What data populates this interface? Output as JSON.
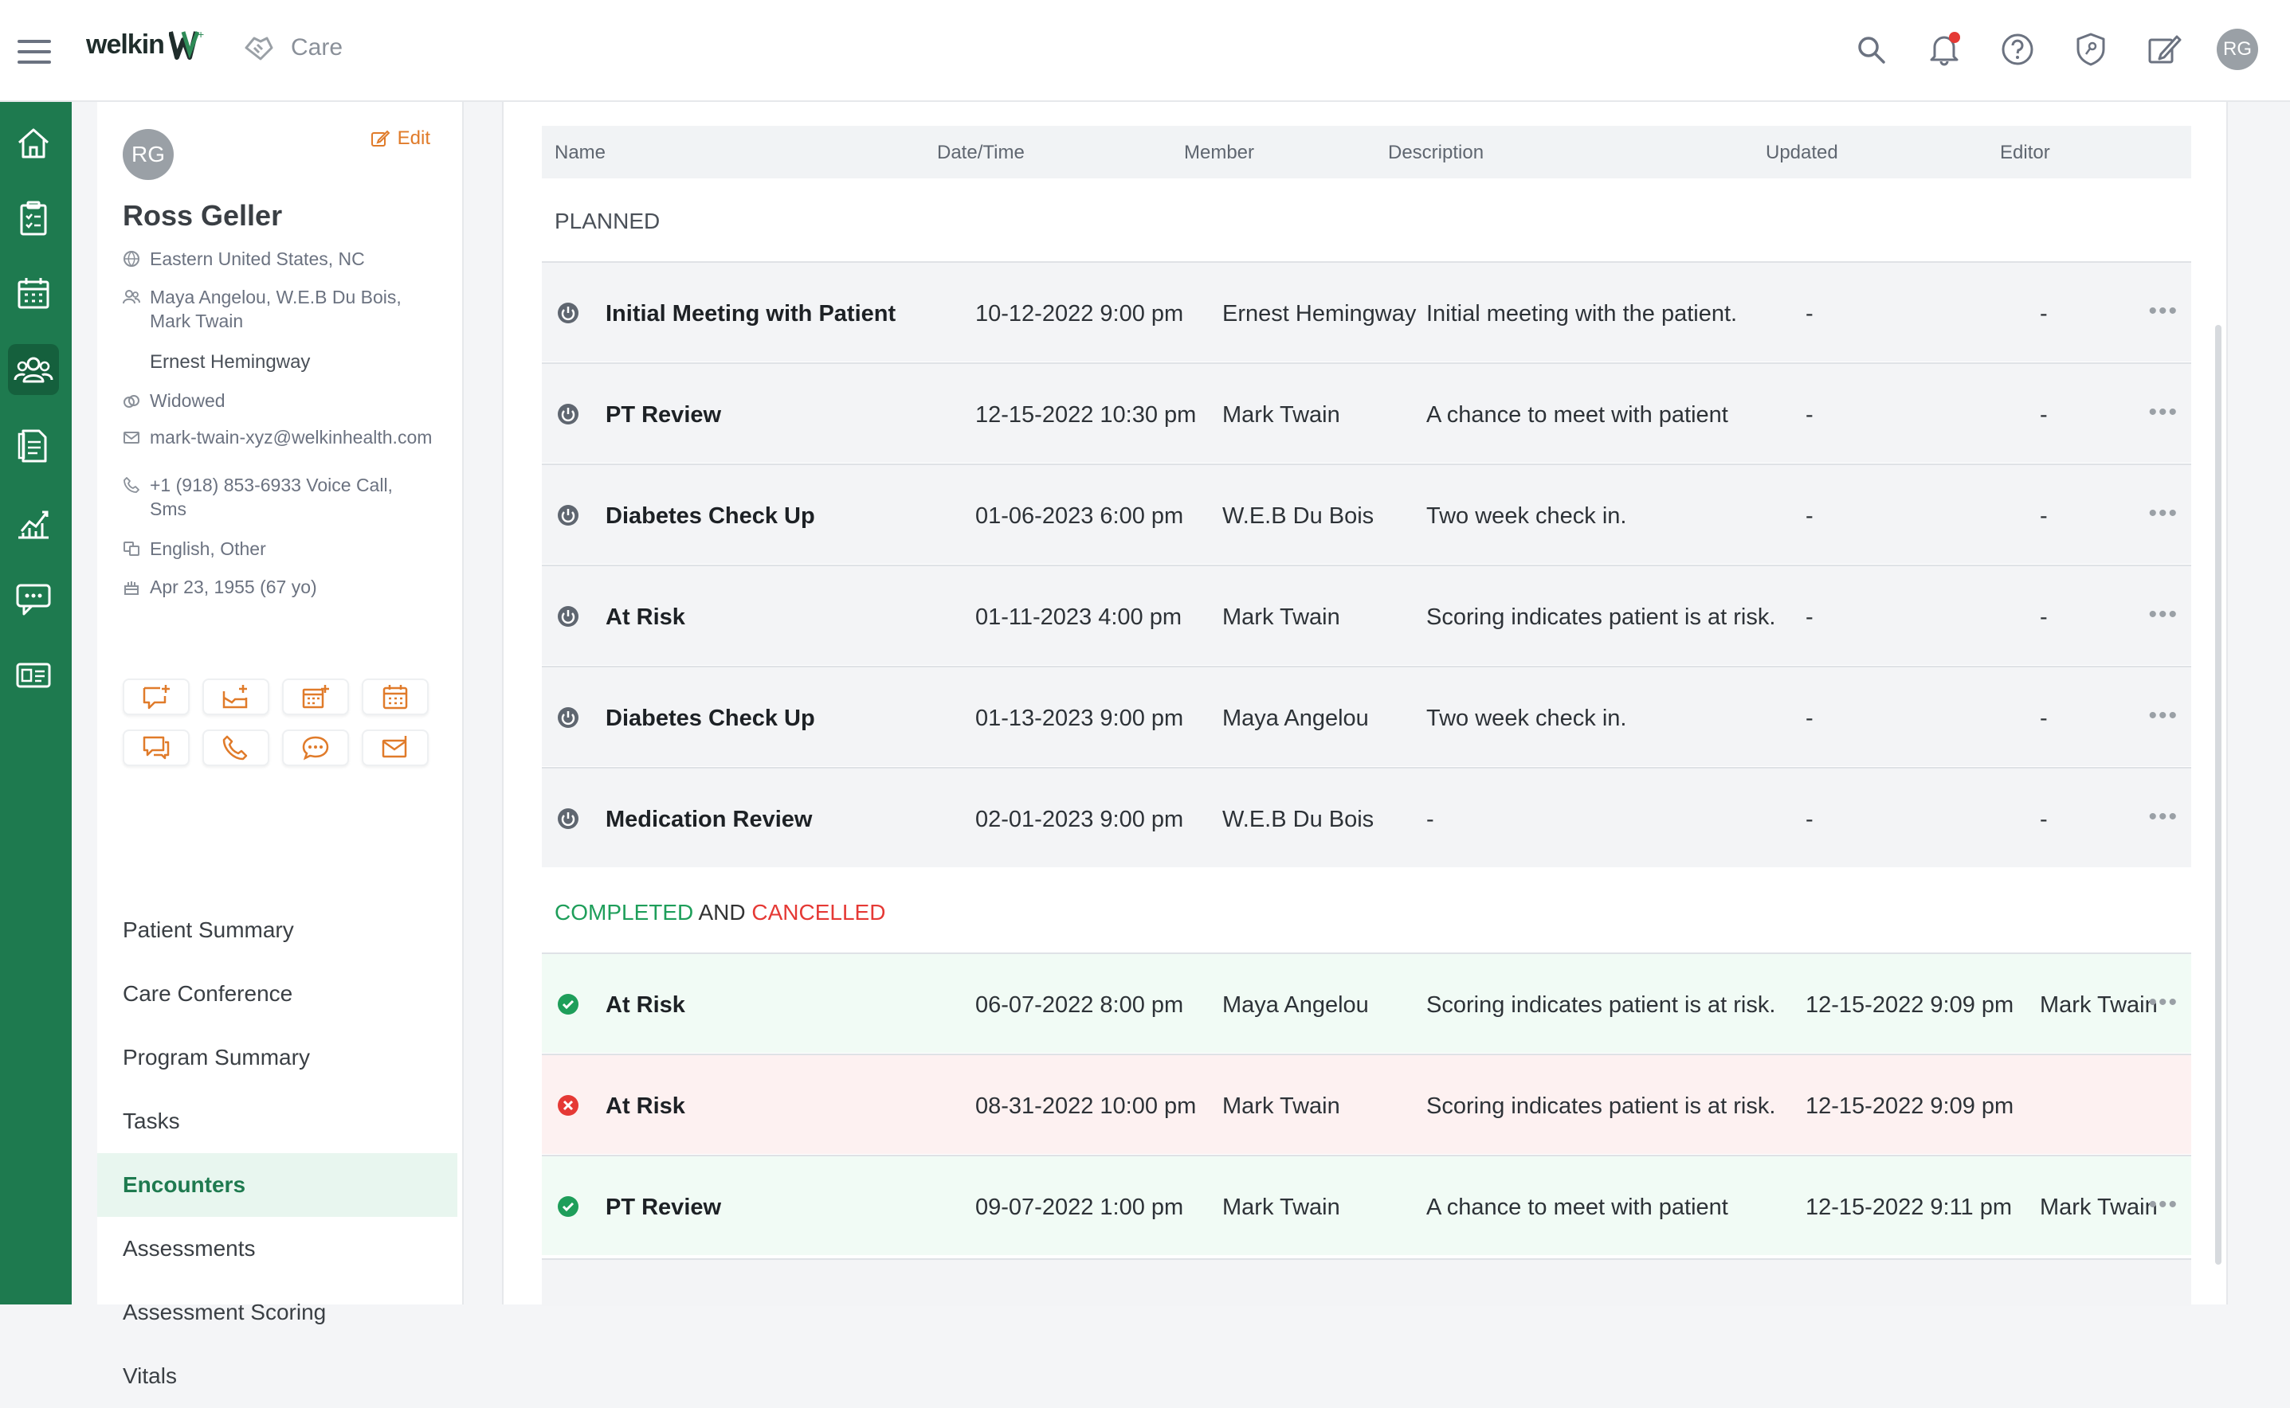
{
  "header": {
    "logo_text": "welkin",
    "module": "Care",
    "user_initials": "RG"
  },
  "patient": {
    "initials": "RG",
    "edit_label": "Edit",
    "name": "Ross Geller",
    "location": "Eastern United States, NC",
    "family_line1": "Maya Angelou, W.E.B Du Bois,",
    "family_line2": "Mark Twain",
    "provider": "Ernest Hemingway",
    "marital": "Widowed",
    "email": "mark-twain-xyz@welkinhealth.com",
    "phone_line1": "+1 (918) 853-6933 Voice Call,",
    "phone_line2": "Sms",
    "languages": "English, Other",
    "dob": "Apr 23, 1955 (67 yo)"
  },
  "side_menu": [
    {
      "label": "Patient Summary"
    },
    {
      "label": "Care Conference"
    },
    {
      "label": "Program Summary"
    },
    {
      "label": "Tasks"
    },
    {
      "label": "Encounters"
    },
    {
      "label": "Assessments"
    },
    {
      "label": "Assessment Scoring"
    },
    {
      "label": "Vitals"
    }
  ],
  "table": {
    "columns": [
      "Name",
      "Date/Time",
      "Member",
      "Description",
      "Updated",
      "Editor"
    ],
    "planned_title": "PLANNED",
    "completed_word": "COMPLETED",
    "and_word": "AND",
    "cancelled_word": "CANCELLED",
    "planned_rows": [
      {
        "name": "Initial Meeting with Patient",
        "datetime": "10-12-2022 9:00 pm",
        "member": "Ernest Hemingway",
        "description": "Initial meeting with the patient.",
        "updated": "-",
        "editor": "-"
      },
      {
        "name": "PT Review",
        "datetime": "12-15-2022 10:30 pm",
        "member": "Mark Twain",
        "description": "A chance to meet with patient",
        "updated": "-",
        "editor": "-"
      },
      {
        "name": "Diabetes Check Up",
        "datetime": "01-06-2023 6:00 pm",
        "member": "W.E.B Du Bois",
        "description": "Two week check in.",
        "updated": "-",
        "editor": "-"
      },
      {
        "name": "At Risk",
        "datetime": "01-11-2023 4:00 pm",
        "member": "Mark Twain",
        "description": "Scoring indicates patient is at risk.",
        "updated": "-",
        "editor": "-"
      },
      {
        "name": "Diabetes Check Up",
        "datetime": "01-13-2023 9:00 pm",
        "member": "Maya Angelou",
        "description": "Two week check in.",
        "updated": "-",
        "editor": "-"
      },
      {
        "name": "Medication Review",
        "datetime": "02-01-2023 9:00 pm",
        "member": "W.E.B Du Bois",
        "description": "-",
        "updated": "-",
        "editor": "-"
      }
    ],
    "done_rows": [
      {
        "status": "completed",
        "name": "At Risk",
        "datetime": "06-07-2022 8:00 pm",
        "member": "Maya Angelou",
        "description": "Scoring indicates patient is at risk.",
        "updated": "12-15-2022 9:09 pm",
        "editor": "Mark Twain"
      },
      {
        "status": "cancelled",
        "name": "At Risk",
        "datetime": "08-31-2022 10:00 pm",
        "member": "Mark Twain",
        "description": "Scoring indicates patient is at risk.",
        "updated": "12-15-2022 9:09 pm",
        "editor": ""
      },
      {
        "status": "completed",
        "name": "PT Review",
        "datetime": "09-07-2022 1:00 pm",
        "member": "Mark Twain",
        "description": "A chance to meet with patient",
        "updated": "12-15-2022 9:11 pm",
        "editor": "Mark Twain"
      }
    ]
  },
  "colors": {
    "brand_green": "#1e7a4f",
    "accent_orange": "#e07b2a",
    "completed_green": "#1e9e5a",
    "cancelled_red": "#e53935"
  }
}
